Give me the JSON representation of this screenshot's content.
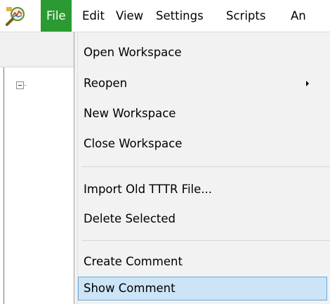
{
  "menubar": {
    "icon": "magnifier-chart-icon",
    "items": [
      {
        "label": "File"
      },
      {
        "label": "Edit"
      },
      {
        "label": "View"
      },
      {
        "label": "Settings"
      },
      {
        "label": "Scripts"
      },
      {
        "label": "An"
      }
    ],
    "active_color": "#2c9a32"
  },
  "dropdown": {
    "items": [
      {
        "label": "Open Workspace"
      },
      {
        "label": "Reopen",
        "submenu": true
      },
      {
        "label": "New Workspace"
      },
      {
        "label": "Close Workspace"
      },
      {
        "label": "Import Old TTTR File..."
      },
      {
        "label": "Delete Selected"
      },
      {
        "label": "Create Comment"
      },
      {
        "label": "Show Comment",
        "highlighted": true
      }
    ],
    "highlight_color": "#cce4f7"
  }
}
